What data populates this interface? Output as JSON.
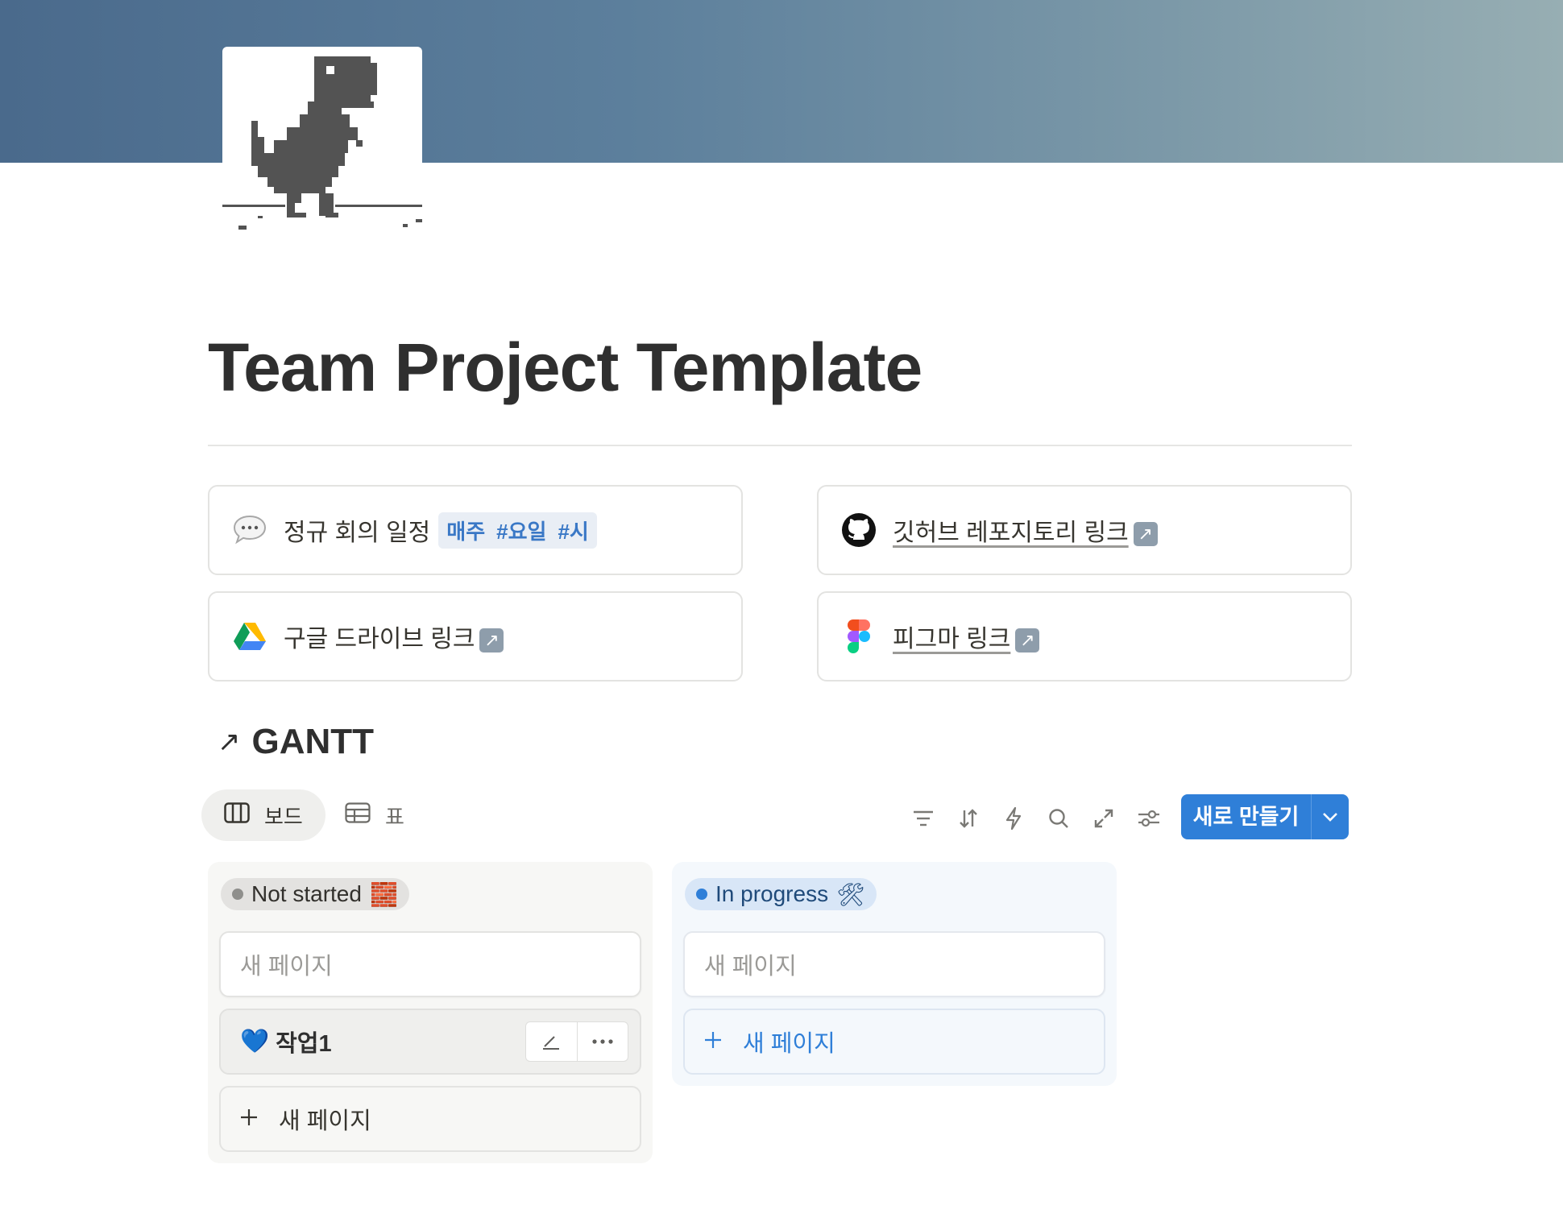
{
  "cover": {
    "colors": [
      "#4a6a8c",
      "#97aeb3"
    ]
  },
  "page_icon": {
    "name": "pixel-dino-icon"
  },
  "title": "Team Project Template",
  "callouts": {
    "meeting": {
      "icon": "speech-bubble-icon",
      "label": "정규 회의 일정",
      "tags": [
        "매주",
        "#요일",
        "#시"
      ]
    },
    "github": {
      "icon": "github-icon",
      "label": "깃허브 레포지토리 링크"
    },
    "drive": {
      "icon": "google-drive-icon",
      "label": "구글 드라이브 링크"
    },
    "figma": {
      "icon": "figma-icon",
      "label": "피그마 링크"
    }
  },
  "database": {
    "title": "GANTT",
    "views": [
      {
        "label": "보드",
        "icon": "board-icon",
        "active": true
      },
      {
        "label": "표",
        "icon": "table-icon",
        "active": false
      }
    ],
    "toolbar": [
      "filter-icon",
      "sort-icon",
      "automation-icon",
      "search-icon",
      "expand-icon",
      "settings-icon"
    ],
    "new_button": "새로 만들기",
    "columns": [
      {
        "status": "Not started",
        "emoji": "🧱",
        "dot_color": "#8f8f8c",
        "placeholder": "새 페이지",
        "cards": [
          {
            "emoji": "💙",
            "title": "작업1"
          }
        ],
        "add_label": "새 페이지"
      },
      {
        "status": "In progress",
        "emoji": "🛠",
        "dot_color": "#2f7fd8",
        "placeholder": "새 페이지",
        "cards": [],
        "add_label": "새 페이지"
      }
    ]
  },
  "accent_color": "#2f7fd8"
}
